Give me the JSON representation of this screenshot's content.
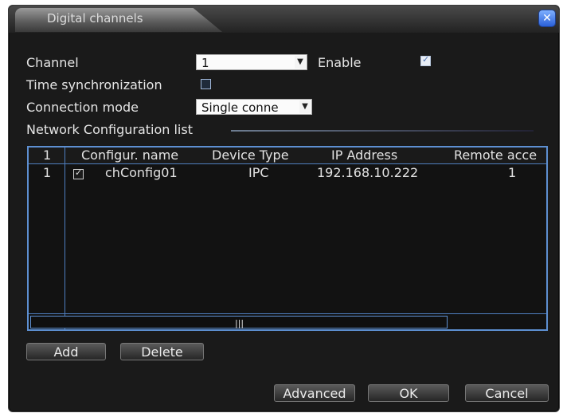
{
  "window": {
    "title": "Digital channels",
    "close_icon": "close-icon"
  },
  "form": {
    "channel_label": "Channel",
    "channel_value": "1",
    "enable_label": "Enable",
    "enable_checked": true,
    "time_sync_label": "Time synchronization",
    "time_sync_checked": false,
    "connection_mode_label": "Connection mode",
    "connection_mode_value": "Single conne",
    "list_title": "Network Configuration list"
  },
  "table": {
    "headers": [
      "1",
      "Configur. name",
      "Device Type",
      "IP Address",
      "Remote acce"
    ],
    "rows": [
      {
        "index": "1",
        "checked": true,
        "name": "chConfig01",
        "device_type": "IPC",
        "ip": "192.168.10.222",
        "remote": "1"
      }
    ]
  },
  "buttons": {
    "add": "Add",
    "delete": "Delete",
    "advanced": "Advanced",
    "ok": "OK",
    "cancel": "Cancel"
  }
}
